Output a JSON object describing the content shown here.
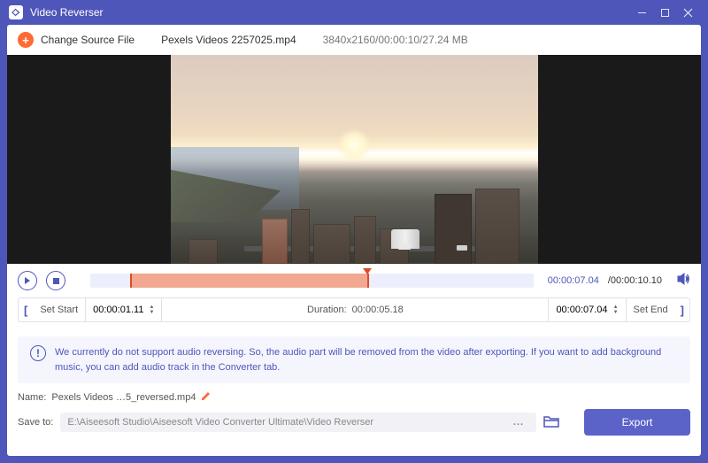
{
  "titlebar": {
    "title": "Video Reverser"
  },
  "toolbar": {
    "change_label": "Change Source File",
    "filename": "Pexels Videos 2257025.mp4",
    "fileinfo": "3840x2160/00:00:10/27.24 MB"
  },
  "playback": {
    "current_time": "00:00:07.04",
    "total_time": "/00:00:10.10"
  },
  "range": {
    "set_start_label": "Set Start",
    "start_time": "00:00:01.11",
    "duration_label": "Duration:",
    "duration_value": "00:00:05.18",
    "end_time": "00:00:07.04",
    "set_end_label": "Set End"
  },
  "notice": {
    "text": "We currently do not support audio reversing. So, the audio part will be removed from the video after exporting. If you want to add background music, you can add audio track in the Converter tab."
  },
  "output": {
    "name_label": "Name:",
    "name_value": "Pexels Videos …5_reversed.mp4",
    "save_label": "Save to:",
    "save_path": "E:\\Aiseesoft Studio\\Aiseesoft Video Converter Ultimate\\Video Reverser",
    "browse_dots": "...",
    "export_label": "Export"
  }
}
